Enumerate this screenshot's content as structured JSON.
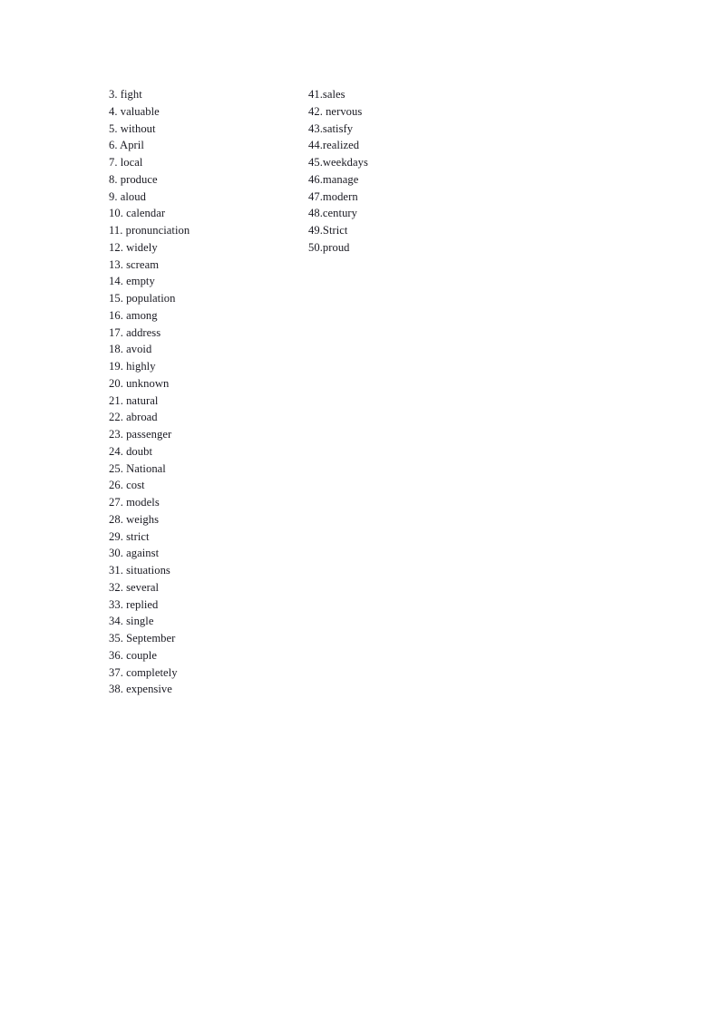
{
  "document": {
    "type": "answer-key-word-list",
    "background_color": "#ffffff",
    "text_color": "#1a1a22"
  },
  "columns": {
    "left": {
      "items": [
        "3. fight",
        "4. valuable",
        "5. without",
        "6. April",
        "7. local",
        "8. produce",
        "9. aloud",
        "10. calendar",
        "11. pronunciation",
        "12. widely",
        "13. scream",
        "14. empty",
        "15. population",
        "16. among",
        "17. address",
        "18. avoid",
        "19. highly",
        "20. unknown",
        "21. natural",
        "22. abroad",
        "23. passenger",
        "24. doubt",
        "25. National",
        "26. cost",
        "27. models",
        "28. weighs",
        "29. strict",
        "30. against",
        "31. situations",
        "32. several",
        "33. replied",
        "34. single",
        "35. September",
        "36. couple",
        "37. completely",
        "38. expensive"
      ]
    },
    "right": {
      "items": [
        "41.sales",
        "42. nervous",
        "43.satisfy",
        "44.realized",
        "45.weekdays",
        "46.manage",
        "47.modern",
        "48.century",
        "49.Strict",
        "50.proud"
      ]
    }
  }
}
